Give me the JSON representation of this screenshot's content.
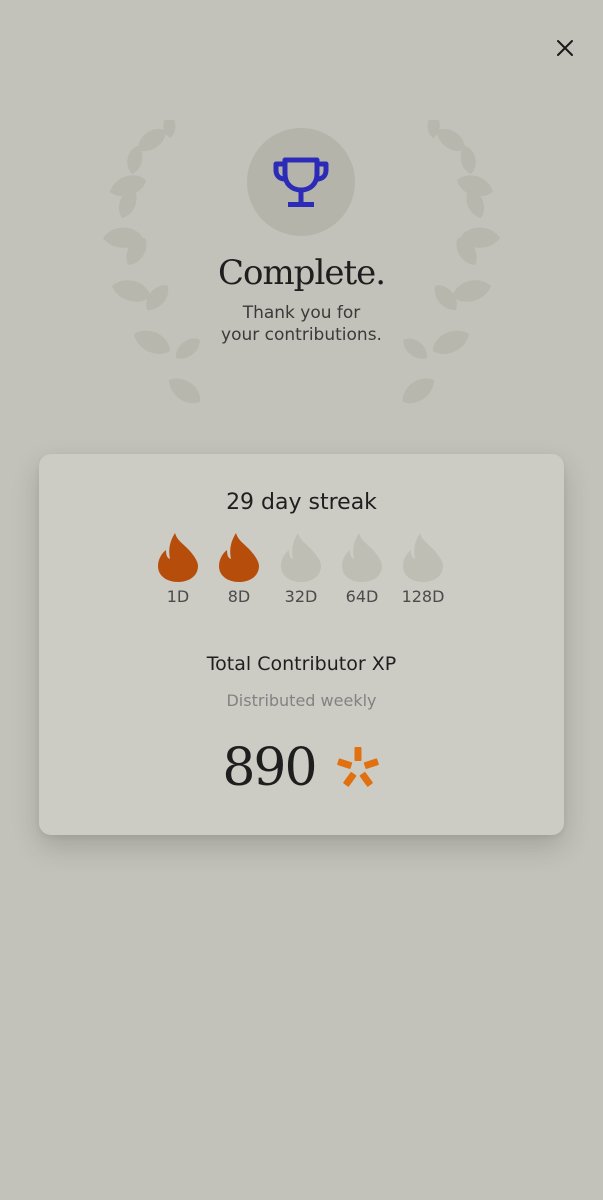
{
  "header": {
    "close_icon": "close-icon"
  },
  "hero": {
    "icon": "trophy-icon",
    "decoration": "laurel-wreath",
    "title": "Complete.",
    "message_line1": "Thank you for",
    "message_line2": "your contributions."
  },
  "streak": {
    "title": "29 day streak",
    "milestones": [
      {
        "label": "1D",
        "achieved": true
      },
      {
        "label": "8D",
        "achieved": true
      },
      {
        "label": "32D",
        "achieved": false
      },
      {
        "label": "64D",
        "achieved": false
      },
      {
        "label": "128D",
        "achieved": false
      }
    ]
  },
  "xp": {
    "title": "Total Contributor XP",
    "subtitle": "Distributed weekly",
    "value": "890",
    "icon": "xp-asterisk-icon"
  },
  "colors": {
    "background": "#c2c2ba",
    "card": "#ccccc4",
    "trophy_circle": "#b4b4ab",
    "trophy": "#2b2bb8",
    "flame_active": "#b64d0a",
    "flame_inactive": "#bebeb5",
    "laurel": "#b7b7ae",
    "xp_icon": "#e07010"
  }
}
